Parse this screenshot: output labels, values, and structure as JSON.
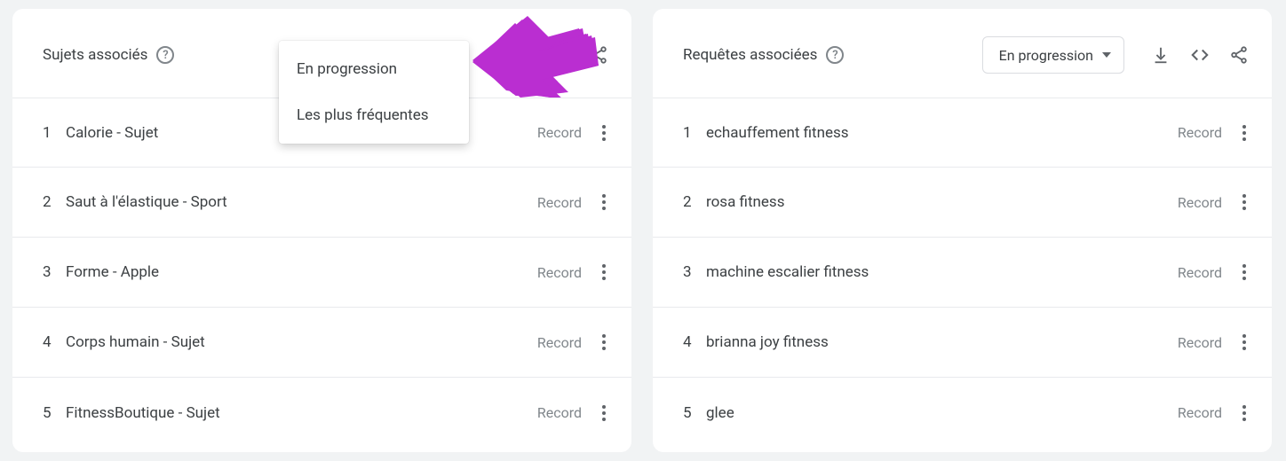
{
  "left": {
    "title": "Sujets associés",
    "dropdown_menu": [
      "En progression",
      "Les plus fréquentes"
    ],
    "rows": [
      {
        "rank": "1",
        "label": "Calorie - Sujet",
        "value": "Record"
      },
      {
        "rank": "2",
        "label": "Saut à l'élastique - Sport",
        "value": "Record"
      },
      {
        "rank": "3",
        "label": "Forme - Apple",
        "value": "Record"
      },
      {
        "rank": "4",
        "label": "Corps humain - Sujet",
        "value": "Record"
      },
      {
        "rank": "5",
        "label": "FitnessBoutique - Sujet",
        "value": "Record"
      }
    ]
  },
  "right": {
    "title": "Requêtes associées",
    "dropdown_selected": "En progression",
    "rows": [
      {
        "rank": "1",
        "label": "echauffement fitness",
        "value": "Record"
      },
      {
        "rank": "2",
        "label": "rosa fitness",
        "value": "Record"
      },
      {
        "rank": "3",
        "label": "machine escalier fitness",
        "value": "Record"
      },
      {
        "rank": "4",
        "label": "brianna joy fitness",
        "value": "Record"
      },
      {
        "rank": "5",
        "label": "glee",
        "value": "Record"
      }
    ]
  },
  "arrow_color": "#ba2ed1"
}
